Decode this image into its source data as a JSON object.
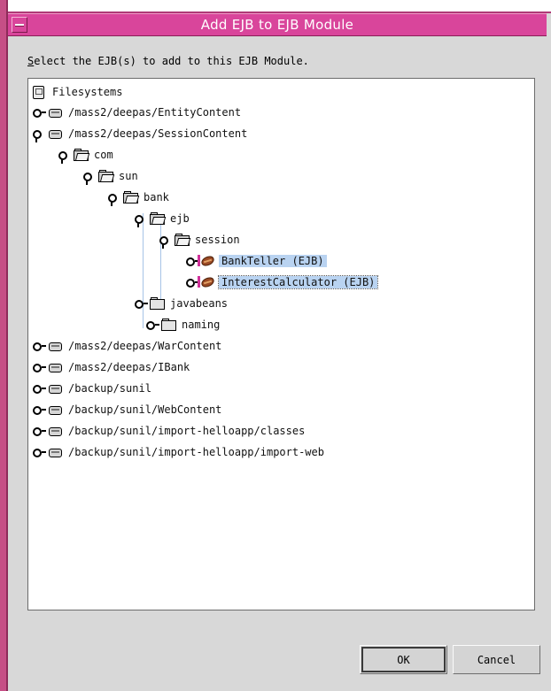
{
  "window": {
    "title": "Add EJB to EJB Module",
    "menu_icon": "window-menu-icon"
  },
  "instruction": {
    "mnemonic": "S",
    "rest": "elect the EJB(s) to add to this EJB Module."
  },
  "tree": {
    "root": {
      "label": "Filesystems",
      "icon": "filesystems-icon"
    },
    "entity_content": {
      "label": "/mass2/deepas/EntityContent",
      "icon": "drive-icon",
      "state": "collapsed"
    },
    "session_content": {
      "label": "/mass2/deepas/SessionContent",
      "icon": "drive-icon",
      "state": "expanded"
    },
    "com": {
      "label": "com",
      "icon": "folder-open-icon",
      "state": "expanded"
    },
    "sun": {
      "label": "sun",
      "icon": "folder-open-icon",
      "state": "expanded"
    },
    "bank": {
      "label": "bank",
      "icon": "folder-open-icon",
      "state": "expanded"
    },
    "ejb": {
      "label": "ejb",
      "icon": "folder-open-icon",
      "state": "expanded"
    },
    "session": {
      "label": "session",
      "icon": "folder-open-icon",
      "state": "expanded"
    },
    "bank_teller": {
      "label": "BankTeller (EJB)",
      "icon": "bean-icon",
      "state": "collapsed",
      "selected": true
    },
    "interest_calculator": {
      "label": "InterestCalculator (EJB)",
      "icon": "bean-icon",
      "state": "collapsed",
      "selected": true
    },
    "javabeans": {
      "label": "javabeans",
      "icon": "folder-icon",
      "state": "collapsed"
    },
    "naming": {
      "label": "naming",
      "icon": "folder-icon",
      "state": "collapsed"
    },
    "war_content": {
      "label": "/mass2/deepas/WarContent",
      "icon": "drive-icon",
      "state": "collapsed"
    },
    "ibank": {
      "label": "/mass2/deepas/IBank",
      "icon": "drive-icon",
      "state": "collapsed"
    },
    "sunil": {
      "label": "/backup/sunil",
      "icon": "drive-icon",
      "state": "collapsed"
    },
    "web_content": {
      "label": "/backup/sunil/WebContent",
      "icon": "drive-icon",
      "state": "collapsed"
    },
    "import_classes": {
      "label": "/backup/sunil/import-helloapp/classes",
      "icon": "drive-icon",
      "state": "collapsed"
    },
    "import_web": {
      "label": "/backup/sunil/import-helloapp/import-web",
      "icon": "drive-icon",
      "state": "collapsed"
    }
  },
  "buttons": {
    "ok": "OK",
    "cancel": "Cancel"
  },
  "colors": {
    "title_bar": "#d9459b",
    "selection": "#b9d3f1",
    "dialog_bg": "#d8d8d8"
  }
}
